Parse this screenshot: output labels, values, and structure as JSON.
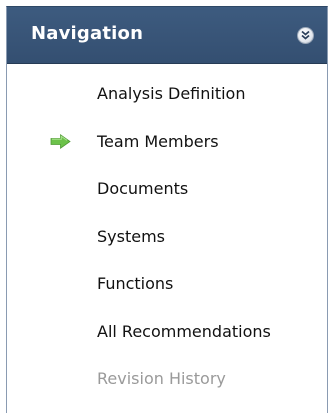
{
  "navigation": {
    "title": "Navigation",
    "collapse_icon": "double-chevron-down-icon",
    "current_indicator_icon": "green-arrow-right-icon",
    "items": [
      {
        "label": "Analysis Definition",
        "current": false,
        "enabled": true
      },
      {
        "label": "Team Members",
        "current": true,
        "enabled": true
      },
      {
        "label": "Documents",
        "current": false,
        "enabled": true
      },
      {
        "label": "Systems",
        "current": false,
        "enabled": true
      },
      {
        "label": "Functions",
        "current": false,
        "enabled": true
      },
      {
        "label": "All Recommendations",
        "current": false,
        "enabled": true
      },
      {
        "label": "Revision History",
        "current": false,
        "enabled": false
      }
    ]
  },
  "colors": {
    "header_bg": "#3d5b7f",
    "header_text": "#ffffff",
    "arrow": "#6cc24a",
    "disabled_text": "#9a9a9a"
  }
}
